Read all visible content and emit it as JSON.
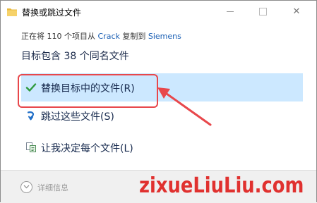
{
  "window": {
    "title": "替换或跳过文件",
    "close_glyph": "✕"
  },
  "copy_info": {
    "prefix": "正在将 110 个项目从",
    "source": "Crack",
    "middle": "复制到",
    "destination": "Siemens"
  },
  "heading": "目标包含 38 个同名文件",
  "options": {
    "replace": "替换目标中的文件(R)",
    "skip": "跳过这些文件(S)",
    "decide": "让我决定每个文件(L)"
  },
  "footer": {
    "details": "详细信息"
  },
  "watermark": "zixueLiuLiu.com",
  "colors": {
    "selected_bg": "#cce8ff",
    "annotation": "#e8474b",
    "link": "#1a5fb4"
  },
  "icons": {
    "title": "folder-icon",
    "replace": "checkmark-icon",
    "skip": "skip-arrow-icon",
    "decide": "file-compare-icon",
    "details": "chevron-down-icon"
  }
}
